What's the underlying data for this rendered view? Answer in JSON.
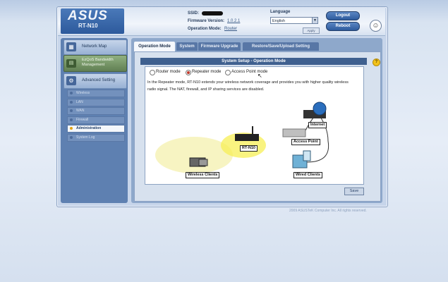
{
  "header": {
    "brand": "ASUS",
    "model": "RT-N10",
    "ssid_label": "SSID:",
    "firmware_label": "Firmware Version:",
    "firmware_value": "1.0.2.1",
    "opmode_label": "Operation Mode:",
    "opmode_value": "Router",
    "language_label": "Language",
    "language_value": "English",
    "apply_label": "Apply",
    "logout_label": "Logout",
    "reboot_label": "Reboot"
  },
  "sidebar": {
    "network_map": "Network Map",
    "ezqos": "EzQoS Bandwidth Management",
    "advanced": "Advanced Setting",
    "items": [
      {
        "label": "Wireless"
      },
      {
        "label": "LAN"
      },
      {
        "label": "WAN"
      },
      {
        "label": "Firewall"
      },
      {
        "label": "Administration"
      },
      {
        "label": "System Log"
      }
    ]
  },
  "tabs": [
    {
      "label": "Operation Mode"
    },
    {
      "label": "System"
    },
    {
      "label": "Firmware Upgrade"
    },
    {
      "label": "Restore/Save/Upload Setting"
    }
  ],
  "panel": {
    "title": "System Setup - Operation Mode",
    "modes": [
      {
        "label": "Router mode",
        "selected": false
      },
      {
        "label": "Repeater mode",
        "selected": true
      },
      {
        "label": "Access Point mode",
        "selected": false
      }
    ],
    "description": "In the Repeater mode, RT-N10 extends your wireless network coverage and provides you with higher quality wireless radio signal. The NAT, firewall, and IP sharing services are disabled.",
    "diagram_labels": {
      "internet": "Internet",
      "router": "RT-N10",
      "access_point": "Access Point",
      "wireless_clients": "Wireless Clients",
      "wired_clients": "Wired Clients"
    },
    "save_label": "Save"
  },
  "footer": "2009 ASUSTeK Computer Inc. All rights reserved."
}
